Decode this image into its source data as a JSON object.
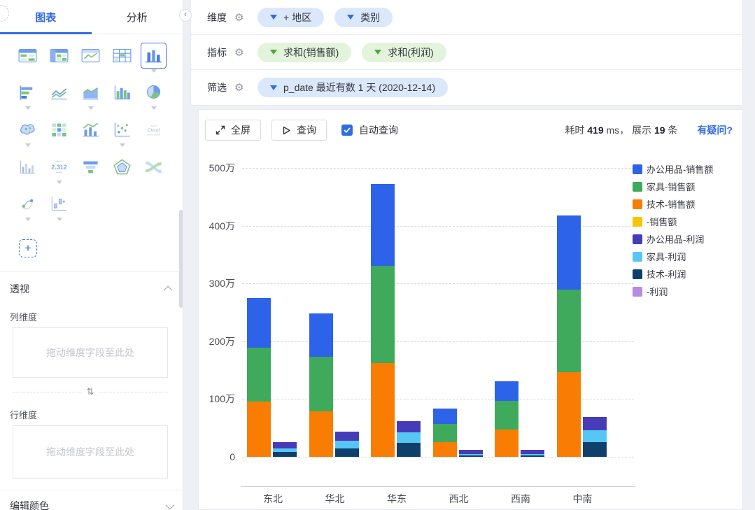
{
  "colors": {
    "accent_blue": "#2f6be4",
    "metric_green": "#4ca63c",
    "pill_dimension_bg": "#dbe8fc",
    "pill_metric_bg": "#e4f3dc"
  },
  "sidebar": {
    "tabs": [
      {
        "label": "图表",
        "active": true
      },
      {
        "label": "分析",
        "active": false
      }
    ],
    "collapse_icon": "chevron-left",
    "chart_types": [
      {
        "name": "table",
        "caret": false,
        "selected": false
      },
      {
        "name": "pivot-table",
        "caret": false,
        "selected": false
      },
      {
        "name": "trend-table",
        "caret": false,
        "selected": false
      },
      {
        "name": "detail-table",
        "caret": false,
        "selected": false
      },
      {
        "name": "bar-chart",
        "caret": true,
        "selected": true
      },
      {
        "name": "horizontal-bar",
        "caret": true,
        "selected": false
      },
      {
        "name": "line-chart",
        "caret": false,
        "selected": false
      },
      {
        "name": "area-chart",
        "caret": true,
        "selected": false
      },
      {
        "name": "histogram",
        "caret": false,
        "selected": false
      },
      {
        "name": "pie-chart",
        "caret": true,
        "selected": false
      },
      {
        "name": "map",
        "caret": true,
        "selected": false
      },
      {
        "name": "heatmap",
        "caret": false,
        "selected": false
      },
      {
        "name": "combo-chart",
        "caret": false,
        "selected": false
      },
      {
        "name": "scatter-plot",
        "caret": true,
        "selected": false
      },
      {
        "name": "word-cloud",
        "caret": false,
        "selected": false
      },
      {
        "name": "mini-bar",
        "caret": false,
        "selected": false
      },
      {
        "name": "number-card",
        "caret": true,
        "selected": false
      },
      {
        "name": "funnel",
        "caret": false,
        "selected": false
      },
      {
        "name": "radar",
        "caret": false,
        "selected": false
      },
      {
        "name": "sankey",
        "caret": false,
        "selected": false
      },
      {
        "name": "flow-map",
        "caret": true,
        "selected": false
      },
      {
        "name": "step-chart",
        "caret": true,
        "selected": false
      }
    ],
    "number_card_text": "2.312",
    "word_cloud_text": "Cloud",
    "add_button_label": "+",
    "pivot": {
      "title": "透视",
      "column_label": "列维度",
      "column_placeholder": "拖动维度字段至此处",
      "row_label": "行维度",
      "row_placeholder": "拖动维度字段至此处"
    },
    "edit_color_label": "编辑颜色"
  },
  "config": {
    "rows": [
      {
        "label": "维度",
        "pills": [
          {
            "text": "+ 地区",
            "type": "dimension"
          },
          {
            "text": "类别",
            "type": "dimension"
          }
        ]
      },
      {
        "label": "指标",
        "pills": [
          {
            "text": "求和(销售额)",
            "type": "metric"
          },
          {
            "text": "求和(利润)",
            "type": "metric"
          }
        ]
      },
      {
        "label": "筛选",
        "pills": [
          {
            "text": "p_date 最近有数 1 天 (2020-12-14)",
            "type": "dimension"
          }
        ]
      }
    ]
  },
  "toolbar": {
    "fullscreen_label": "全屏",
    "query_label": "查询",
    "auto_query_label": "自动查询",
    "auto_query_checked": true,
    "stats": {
      "time_label": "耗时",
      "time_value": "419",
      "time_suffix": "ms，",
      "count_label": "展示",
      "count_value": "19",
      "count_suffix": "条"
    },
    "doubt_link": "有疑问?"
  },
  "chart_data": {
    "type": "bar",
    "stacked": true,
    "unit": "万",
    "categories": [
      "东北",
      "华北",
      "华东",
      "西北",
      "西南",
      "中南"
    ],
    "y_ticks": [
      "500万",
      "400万",
      "300万",
      "200万",
      "100万",
      "0"
    ],
    "ylim": [
      0,
      500
    ],
    "grid": true,
    "legend_position": "right",
    "series": [
      {
        "name": "技术-销售额",
        "bar": "sales",
        "color": "#f97d02",
        "values": [
          96,
          79,
          162,
          25,
          47,
          146
        ]
      },
      {
        "name": "家具-销售额",
        "bar": "sales",
        "color": "#3fa95c",
        "values": [
          93,
          94,
          168,
          32,
          50,
          143
        ]
      },
      {
        "name": "办公用品-销售额",
        "bar": "sales",
        "color": "#2d63e8",
        "values": [
          86,
          75,
          142,
          26,
          34,
          129
        ]
      },
      {
        "name": "-销售额",
        "bar": "sales",
        "color": "#f9c400",
        "values": [
          0,
          0,
          0,
          0,
          0,
          0
        ]
      },
      {
        "name": "技术-利润",
        "bar": "profit",
        "color": "#0f3f6b",
        "values": [
          9,
          14,
          24,
          3,
          2,
          26
        ]
      },
      {
        "name": "家具-利润",
        "bar": "profit",
        "color": "#56c7f5",
        "values": [
          6,
          14,
          18,
          2,
          3,
          20
        ]
      },
      {
        "name": "办公用品-利润",
        "bar": "profit",
        "color": "#473cb8",
        "values": [
          11,
          16,
          20,
          7,
          7,
          23
        ]
      },
      {
        "name": "-利润",
        "bar": "profit",
        "color": "#b78be0",
        "values": [
          0,
          0,
          0,
          0,
          0,
          0
        ]
      }
    ],
    "legend": [
      {
        "label": "办公用品-销售额",
        "color": "#2d63e8"
      },
      {
        "label": "家具-销售额",
        "color": "#3fa95c"
      },
      {
        "label": "技术-销售额",
        "color": "#f97d02"
      },
      {
        "label": "-销售额",
        "color": "#f9c400"
      },
      {
        "label": "办公用品-利润",
        "color": "#473cb8"
      },
      {
        "label": "家具-利润",
        "color": "#56c7f5"
      },
      {
        "label": "技术-利润",
        "color": "#0f3f6b"
      },
      {
        "label": "-利润",
        "color": "#b78be0"
      }
    ]
  }
}
